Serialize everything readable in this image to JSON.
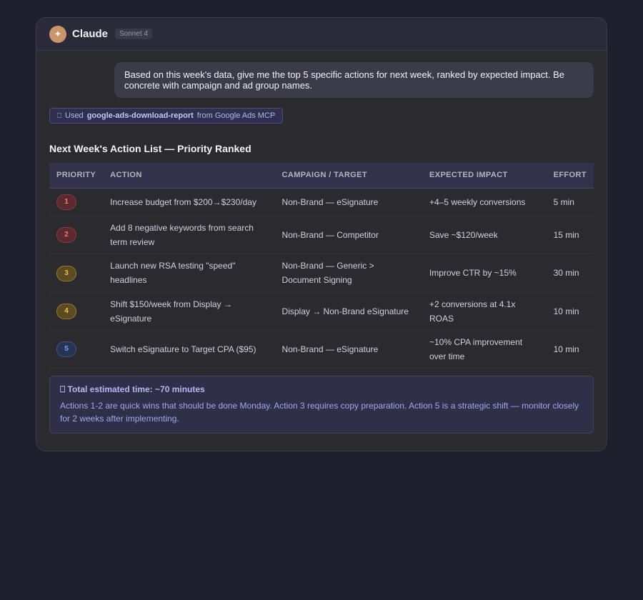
{
  "header": {
    "app_title": "Claude",
    "model_badge": "Sonnet 4",
    "avatar_icon": "sparkle-icon"
  },
  "user_message": "Based on this week's data, give me the top 5 specific actions for next week, ranked by expected impact. Be concrete with campaign and ad group names.",
  "tool_usage": {
    "icon": "wrench-icon",
    "prefix": "Used",
    "tool_name": "google-ads-download-report",
    "suffix": "from Google Ads MCP"
  },
  "section_title": "Next Week's Action List — Priority Ranked",
  "table": {
    "columns": [
      "PRIORITY",
      "ACTION",
      "CAMPAIGN / TARGET",
      "EXPECTED IMPACT",
      "EFFORT"
    ],
    "rows": [
      {
        "priority": "1",
        "action": "Increase budget from $200→$230/day",
        "campaign": "Non-Brand — eSignature",
        "impact": "+4–5 weekly conversions",
        "effort": "5 min"
      },
      {
        "priority": "2",
        "action": "Add 8 negative keywords from search term review",
        "campaign": "Non-Brand — Competitor",
        "impact": "Save ~$120/week",
        "effort": "15 min"
      },
      {
        "priority": "3",
        "action": "Launch new RSA testing \"speed\" headlines",
        "campaign": "Non-Brand — Generic > Document Signing",
        "impact": "Improve CTR by ~15%",
        "effort": "30 min"
      },
      {
        "priority": "4",
        "action": "Shift $150/week from Display → eSignature",
        "campaign": "Display → Non-Brand eSignature",
        "impact": "+2 conversions at 4.1x ROAS",
        "effort": "10 min"
      },
      {
        "priority": "5",
        "action": "Switch eSignature to Target CPA ($95)",
        "campaign": "Non-Brand — eSignature",
        "impact": "~10% CPA improvement over time",
        "effort": "10 min"
      }
    ]
  },
  "summary": {
    "icon": "clock-icon",
    "title": "Total estimated time: ~70 minutes",
    "body": "Actions 1-2 are quick wins that should be done Monday. Action 3 requires copy preparation. Action 5 is a strategic shift — monitor closely for 2 weeks after implementing."
  },
  "colors": {
    "page_bg": "#201f2e",
    "card_bg": "#2a2a2f",
    "high_priority": "#f17b7b",
    "medium_priority": "#f0c341",
    "low_priority": "#7ca3ef",
    "accent": "#b7b6f2"
  }
}
